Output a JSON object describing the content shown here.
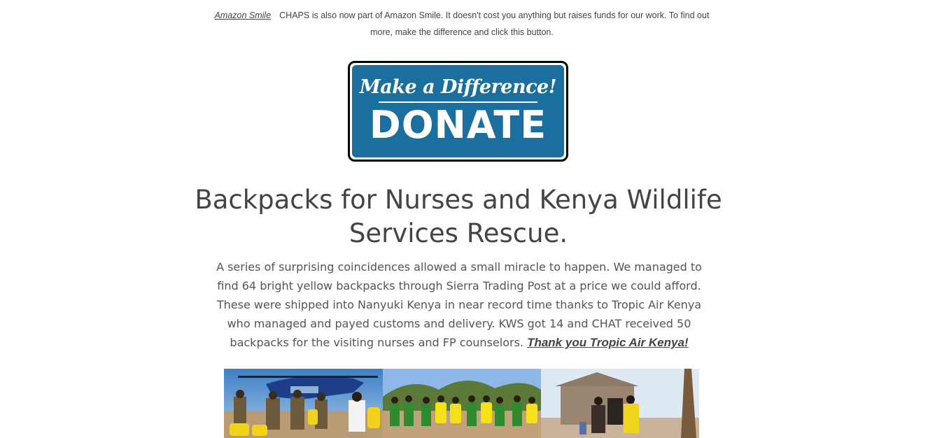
{
  "amazon": {
    "link_text": "Amazon Smile",
    "message": "CHAPS is also now part of Amazon Smile.  It doesn't cost you anything but raises funds for our work. To find out more, make the difference and click this button."
  },
  "donate_button": {
    "tagline": "Make a Difference!",
    "label": "DONATE",
    "color": "#1a6f9f"
  },
  "article": {
    "headline": "Backpacks for Nurses and Kenya Wildlife Services Rescue.",
    "body": "A series of surprising coincidences allowed a small miracle to happen.   We managed to find 64 bright yellow backpacks through Sierra Trading Post at a price we could afford.  These were shipped into Nanyuki Kenya in near record time thanks to Tropic Air Kenya who managed and payed customs and delivery.  KWS got 14 and CHAT received 50 backpacks for the visiting nurses and FP counselors.",
    "thanks_link": "Thank you Tropic Air Kenya!"
  },
  "gallery": {
    "photos": [
      {
        "subject": "helicopter-rangers-photo"
      },
      {
        "subject": "nurses-group-photo"
      },
      {
        "subject": "hut-visit-photo"
      }
    ]
  }
}
